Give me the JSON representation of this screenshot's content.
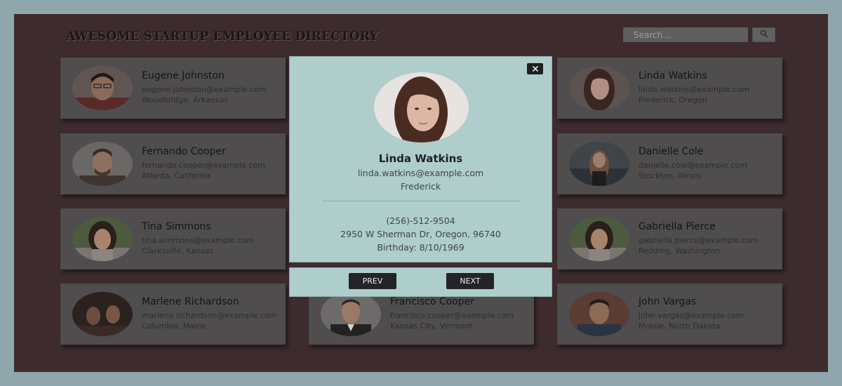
{
  "header": {
    "title": "AWESOME STARTUP EMPLOYEE DIRECTORY",
    "search_placeholder": "Search...",
    "search_icon": "magnifier-icon"
  },
  "employees": [
    {
      "name": "Eugene Johnston",
      "email": "eugene.johnston@example.com",
      "location": "Woodbridge, Arkansas"
    },
    {
      "name": "Linda Watkins",
      "email": "linda.watkins@example.com",
      "location": "Frederick, Oregon"
    },
    {
      "name": "Fernando Cooper",
      "email": "fernando.cooper@example.com",
      "location": "Atlanta, California"
    },
    {
      "name": "Danielle Cole",
      "email": "danielle.cole@example.com",
      "location": "Stockton, Illinois"
    },
    {
      "name": "Tina Simmons",
      "email": "tina.simmons@example.com",
      "location": "Clarksville, Kansas"
    },
    {
      "name": "Gabriella Pierce",
      "email": "gabriella.pierce@example.com",
      "location": "Redding, Washington"
    },
    {
      "name": "Marlene Richardson",
      "email": "marlene.richardson@example.com",
      "location": "Columbia, Maine"
    },
    {
      "name": "Francisco Cooper",
      "email": "francisco.cooper@example.com",
      "location": "Kansas City, Vermont"
    },
    {
      "name": "John Vargas",
      "email": "john.vargas@example.com",
      "location": "Mobile, North Dakota"
    }
  ],
  "modal": {
    "name": "Linda Watkins",
    "email": "linda.watkins@example.com",
    "city": "Frederick",
    "phone": "(256)-512-9504",
    "address": "2950 W Sherman Dr, Oregon, 96740",
    "birthday": "Birthday: 8/10/1969",
    "close_icon": "close-icon",
    "prev_label": "PREV",
    "next_label": "NEXT"
  },
  "colors": {
    "page_border": "#8fa7ac",
    "backdrop": "#3d2b2e",
    "card": "#4f4d4e",
    "modal": "#afcdca",
    "button": "#232425"
  }
}
